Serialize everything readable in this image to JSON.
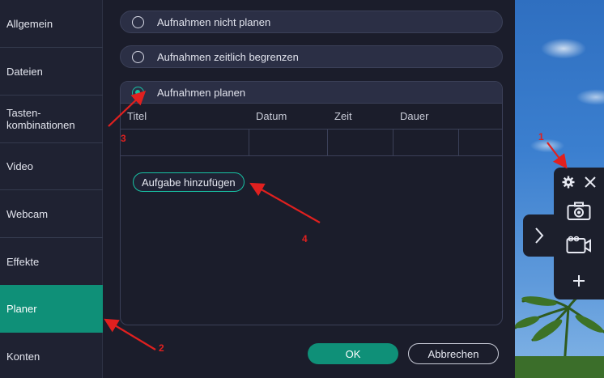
{
  "sidebar": {
    "items": [
      {
        "label": "Allgemein"
      },
      {
        "label": "Dateien"
      },
      {
        "label": "Tasten-\n kombinationen"
      },
      {
        "label": "Video"
      },
      {
        "label": "Webcam"
      },
      {
        "label": "Effekte"
      },
      {
        "label": "Planer",
        "active": true
      },
      {
        "label": "Konten"
      }
    ]
  },
  "options": {
    "no_plan": "Aufnahmen nicht planen",
    "time_limit": "Aufnahmen zeitlich begrenzen",
    "plan": "Aufnahmen planen",
    "selected": "plan"
  },
  "table": {
    "columns": [
      "Titel",
      "Datum",
      "Zeit",
      "Dauer"
    ]
  },
  "add_task_label": "Aufgabe hinzufügen",
  "footer": {
    "ok_label": "OK",
    "cancel_label": "Abbrechen"
  },
  "toolbar": {
    "icons": [
      "gear-icon",
      "close-icon",
      "camera-icon",
      "video-camera-icon",
      "plus-icon",
      "chevron-right-icon"
    ]
  },
  "annotations": [
    "1",
    "2",
    "3",
    "4"
  ],
  "colors": {
    "accent": "#0f9078",
    "radio_accent": "#18c1a3",
    "annotation": "#e0201f",
    "background": "#1b1d2b"
  }
}
